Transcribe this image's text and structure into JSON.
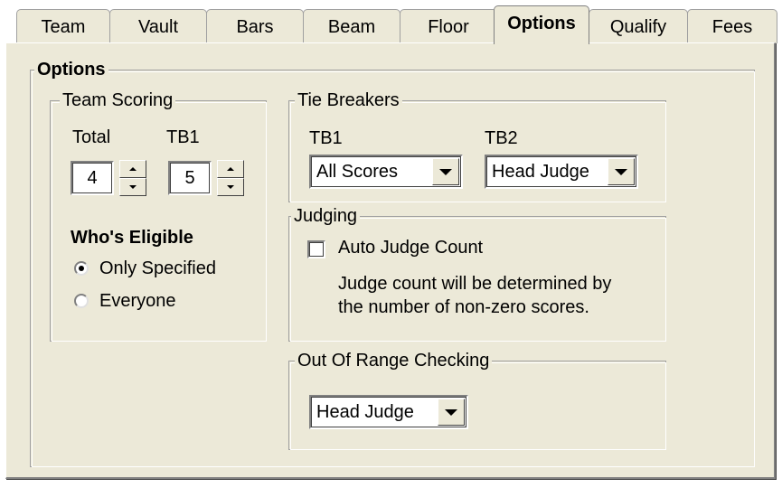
{
  "tabs": [
    {
      "label": "Team"
    },
    {
      "label": "Vault"
    },
    {
      "label": "Bars"
    },
    {
      "label": "Beam"
    },
    {
      "label": "Floor"
    },
    {
      "label": "Options",
      "active": true
    },
    {
      "label": "Qualify"
    },
    {
      "label": "Fees"
    }
  ],
  "options": {
    "title": "Options",
    "team_scoring": {
      "title": "Team Scoring",
      "total_label": "Total",
      "total_value": "4",
      "tb1_label": "TB1",
      "tb1_value": "5",
      "eligible_title": "Who's Eligible",
      "radio_only": "Only Specified",
      "radio_everyone": "Everyone",
      "selected": "Only Specified"
    },
    "tie_breakers": {
      "title": "Tie Breakers",
      "tb1_label": "TB1",
      "tb1_value": "All Scores",
      "tb2_label": "TB2",
      "tb2_value": "Head Judge"
    },
    "judging": {
      "title": "Judging",
      "auto_label": "Auto Judge Count",
      "auto_checked": false,
      "note_line1": "Judge count will be determined by",
      "note_line2": "the number of non-zero scores."
    },
    "out_of_range": {
      "title": "Out Of Range Checking",
      "value": "Head Judge"
    }
  }
}
